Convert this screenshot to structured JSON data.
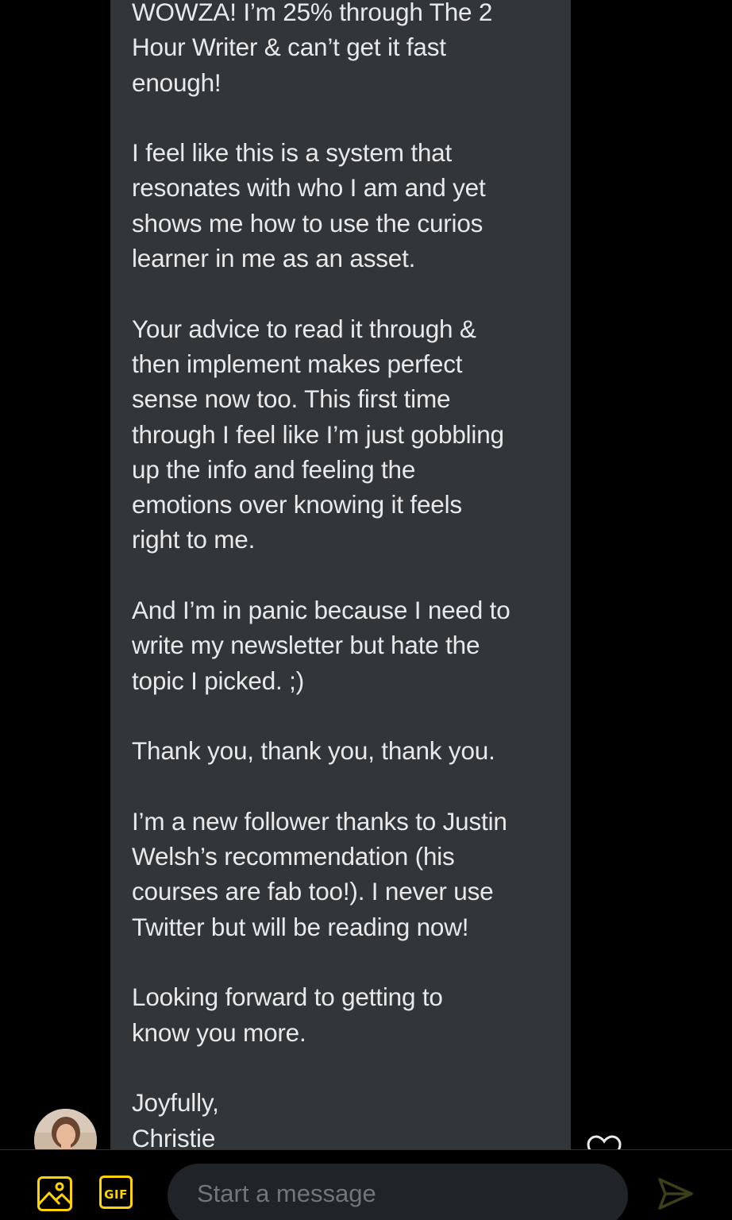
{
  "message": {
    "paragraphs": [
      "WOWZA! I’m 25% through The  2\nHour Writer & can’t get it fast\nenough!",
      "I feel like this is a system that\nresonates with who I am and yet\nshows me how to use the curios\nlearner in me as an asset.",
      "Your advice to read it through &\nthen implement makes perfect\nsense now too. This first time\nthrough I feel like I’m just gobbling\nup the info and feeling the\nemotions over knowing it feels\nright to me.",
      "And I’m in panic because I need to\nwrite my newsletter but hate the\ntopic I picked. ;)",
      "Thank you, thank you, thank you.",
      "I’m a new follower thanks to Justin\nWelsh’s recommendation (his\ncourses are fab too!). I never use\nTwitter but will be reading now!",
      "Looking forward to getting to\nknow you more.",
      "Joyfully,\nChristie"
    ]
  },
  "composer": {
    "placeholder": "Start a message",
    "gif_label": "GIF"
  },
  "icons": {
    "media": "image-icon",
    "gif": "gif-icon",
    "send": "send-icon",
    "react": "heart-icon"
  },
  "colors": {
    "background": "#000000",
    "bubble": "#333639",
    "text": "#e7e9ea",
    "accent": "#ffd400",
    "placeholder": "#71767b"
  }
}
